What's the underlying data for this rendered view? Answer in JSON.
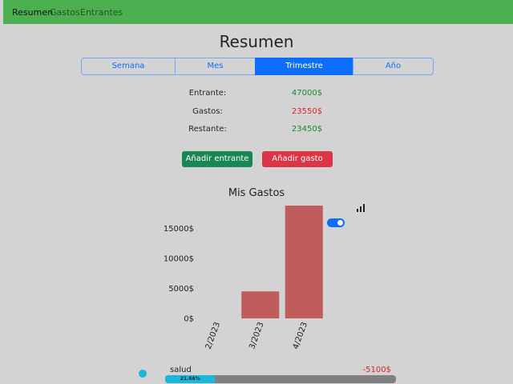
{
  "nav": {
    "items": [
      {
        "label": "Resumen",
        "active": true
      },
      {
        "label": "Gastos",
        "active": false
      },
      {
        "label": "Entrantes",
        "active": false
      }
    ],
    "color": "#4caf50"
  },
  "page_title": "Resumen",
  "tabs": [
    {
      "label": "Semana",
      "active": false
    },
    {
      "label": "Mes",
      "active": false
    },
    {
      "label": "Trimestre",
      "active": true
    },
    {
      "label": "Año",
      "active": false
    }
  ],
  "summary": {
    "income_label": "Entrante:",
    "income_value": "47000$",
    "expenses_label": "Gastos:",
    "expenses_value": "23550$",
    "remaining_label": "Restante:",
    "remaining_value": "23450$"
  },
  "buttons": {
    "add_income": "Añadir entrante",
    "add_expense": "Añadir gasto"
  },
  "chart_icon": "signal-bars-icon",
  "toggle_on": true,
  "chart_data": {
    "type": "bar",
    "title": "Mis Gastos",
    "categories": [
      "2/2023",
      "3/2023",
      "4/2023"
    ],
    "values": [
      0,
      4500,
      18800
    ],
    "y_ticks": [
      "0$",
      "5000$",
      "10000$",
      "15000$"
    ],
    "y_tick_values": [
      0,
      5000,
      10000,
      15000
    ],
    "ylim": [
      0,
      18800
    ],
    "bar_color": "#c05c5c",
    "xlabel": "",
    "ylabel": ""
  },
  "category": {
    "name": "salud",
    "amount": "-5100$",
    "percent_label": "21.66%",
    "percent": 21.66,
    "color": "#19b7d9"
  }
}
